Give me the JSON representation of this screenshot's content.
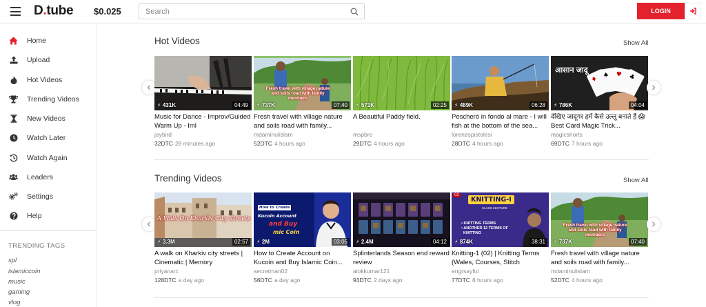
{
  "header": {
    "logo_main": "D",
    "logo_dot": ".",
    "logo_rest": "tube",
    "balance": "$0.025",
    "search_placeholder": "Search",
    "login_label": "LOGIN"
  },
  "sidebar": {
    "items": [
      {
        "label": "Home",
        "icon": "home-icon"
      },
      {
        "label": "Upload",
        "icon": "upload-icon"
      },
      {
        "label": "Hot Videos",
        "icon": "flame-icon"
      },
      {
        "label": "Trending Videos",
        "icon": "trophy-icon"
      },
      {
        "label": "New Videos",
        "icon": "hourglass-icon"
      },
      {
        "label": "Watch Later",
        "icon": "clock-icon"
      },
      {
        "label": "Watch Again",
        "icon": "history-icon"
      },
      {
        "label": "Leaders",
        "icon": "users-icon"
      },
      {
        "label": "Settings",
        "icon": "gears-icon"
      },
      {
        "label": "Help",
        "icon": "question-icon"
      }
    ],
    "trending_heading": "TRENDING TAGS",
    "tags": [
      "spl",
      "islamiccoin",
      "music",
      "gaming",
      "vlog"
    ]
  },
  "hot": {
    "title": "Hot Videos",
    "show_all": "Show All",
    "videos": [
      {
        "views": "431K",
        "duration": "04:49",
        "title": "Music for Dance - Improv/Guided Warm Up - Iml",
        "author": "jaybird",
        "dtc": "32DTC",
        "ago": "28 minutes ago"
      },
      {
        "views": "737K",
        "duration": "07:40",
        "title": "Fresh travel with village nature and soils road with family...",
        "author": "mdaminulislam",
        "dtc": "52DTC",
        "ago": "4 hours ago"
      },
      {
        "views": "571K",
        "duration": "02:25",
        "title": "A Beautiful Paddy field.",
        "author": "mspbro",
        "dtc": "29DTC",
        "ago": "4 hours ago"
      },
      {
        "views": "489K",
        "duration": "06:28",
        "title": "Pescherò in fondo al mare - I will fish at the bottom of the sea...",
        "author": "lorenzopistolesi",
        "dtc": "28DTC",
        "ago": "4 hours ago"
      },
      {
        "views": "786K",
        "duration": "04:04",
        "title": "देखिए जादूगर हमें कैसे उल्लू बनाते हैं 😱 Best Card Magic Trick...",
        "author": "magicshorts",
        "dtc": "69DTC",
        "ago": "7 hours ago"
      }
    ]
  },
  "trending": {
    "title": "Trending Videos",
    "show_all": "Show All",
    "videos": [
      {
        "views": "3.3M",
        "duration": "02:57",
        "title": "A walk on Kharkiv city streets | Cinematic | Memory",
        "author": "priyanarc",
        "dtc": "128DTC",
        "ago": "a day ago"
      },
      {
        "views": "2M",
        "duration": "03:05",
        "title": "How to Create Account on Kucoin and Buy Islamic Coin...",
        "author": "secretman02",
        "dtc": "56DTC",
        "ago": "a day ago"
      },
      {
        "views": "2.4M",
        "duration": "04:12",
        "title": "Splinterlands Season end reward review",
        "author": "alokkumar121",
        "dtc": "93DTC",
        "ago": "2 days ago"
      },
      {
        "views": "874K",
        "duration": "38:31",
        "title": "Knitting-1 (02) | Knitting Terms (Wales, Courses, Stitch Density,...",
        "author": "engrsayful",
        "dtc": "77DTC",
        "ago": "8 hours ago"
      },
      {
        "views": "737K",
        "duration": "07:40",
        "title": "Fresh travel with village nature and soils road with family...",
        "author": "mdaminulislam",
        "dtc": "52DTC",
        "ago": "4 hours ago"
      }
    ]
  },
  "thumb_text": {
    "travel_caption": "Fresh travel with village nature and soils road with family members",
    "magic_caption": "आसान जादू",
    "kharkiv_caption": "A Walk On Kharkiv City Streets",
    "kucoin_line1": "How to Create",
    "kucoin_line2": "Kucoin Account",
    "kucoin_line3": "and Buy",
    "kucoin_line4": "mic Coin",
    "knitting_title": "KNITTING-I",
    "knitting_sub": "CLASS LECTURE",
    "knitting_num": "02",
    "knitting_bullets": "• KNITTING TERMS\n• ANOTHER 12 TERMS OF\n  KNITTING"
  },
  "colors": {
    "accent": "#e4222e",
    "text": "#333333",
    "muted": "#8a8a8a"
  }
}
